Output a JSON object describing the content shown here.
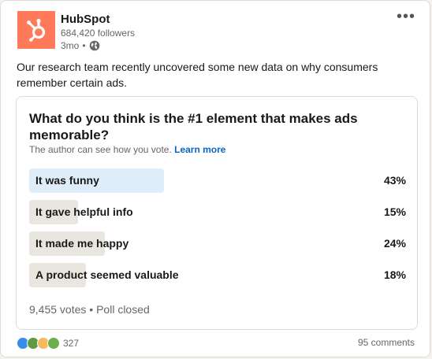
{
  "author": {
    "name": "HubSpot",
    "followers": "684,420 followers",
    "time": "3mo",
    "time_separator": "•",
    "logo_color": "#ff7a59"
  },
  "post": {
    "text": "Our research team recently uncovered some new data on why consumers remember certain ads."
  },
  "poll": {
    "question": "What do you think is the #1 element that makes ads memorable?",
    "note": "The author can see how you vote.",
    "learn_more": "Learn more",
    "options": [
      {
        "label": "It was funny",
        "percent": "43%",
        "value": 43
      },
      {
        "label": "It gave helpful info",
        "percent": "15%",
        "value": 15
      },
      {
        "label": "It made me happy",
        "percent": "24%",
        "value": 24
      },
      {
        "label": "A product seemed valuable",
        "percent": "18%",
        "value": 18
      }
    ],
    "votes": "9,455 votes",
    "status": "Poll closed",
    "footer_separator": "•"
  },
  "social": {
    "reaction_count": "327",
    "comments": "95 comments",
    "reaction_icons": [
      "like-icon",
      "celebrate-icon",
      "insightful-icon",
      "support-icon"
    ]
  },
  "colors": {
    "accent": "#0a66c2",
    "fill": "#e9e5df",
    "fill_selected": "#dfedfb"
  }
}
